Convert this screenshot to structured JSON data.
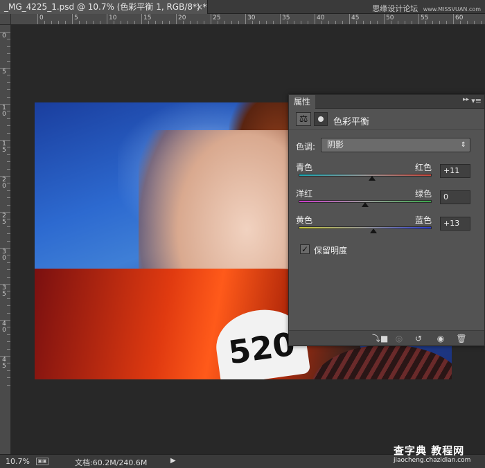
{
  "document_tab": {
    "title": "_MG_4225_1.psd @ 10.7% (色彩平衡 1, RGB/8*) *",
    "close": "×"
  },
  "watermark_top": {
    "text": "思缘设计论坛",
    "site": "www.MISSVUAN.com"
  },
  "ruler": {
    "top_labels": [
      "0",
      "5",
      "10",
      "15",
      "20",
      "25",
      "30",
      "35",
      "40",
      "45",
      "50",
      "55",
      "60"
    ],
    "left_labels": [
      "0",
      "5",
      "1 0",
      "1 5",
      "2 0",
      "2 5",
      "3 0",
      "3 5",
      "4 0",
      "4 5"
    ]
  },
  "canvas": {
    "plate_number": "520"
  },
  "properties_panel": {
    "tab_label": "属性",
    "collapse_icon": "▸▸",
    "menu_icon": "▾≡",
    "adjustment_title": "色彩平衡",
    "tone_label": "色调:",
    "tone_value": "阴影",
    "sliders": [
      {
        "left": "青色",
        "right": "红色",
        "value": "+11",
        "level": 0.55,
        "gradient": [
          "#19a8b4",
          "#c9463a"
        ]
      },
      {
        "left": "洋红",
        "right": "绿色",
        "value": "0",
        "level": 0.5,
        "gradient": [
          "#c93ac9",
          "#3aa64a"
        ]
      },
      {
        "left": "黄色",
        "right": "蓝色",
        "value": "+13",
        "level": 0.56,
        "gradient": [
          "#c9c93a",
          "#2a3ad0"
        ]
      }
    ],
    "preserve_luminosity": {
      "label": "保留明度",
      "checked": true,
      "check_glyph": "✓"
    }
  },
  "status_bar": {
    "zoom": "10.7%",
    "docsize": "文档:60.2M/240.6M",
    "arrow": "▶"
  },
  "watermark_bottom": {
    "text": "查字典 教程网",
    "url": "jiaocheng.chazidian.com"
  }
}
